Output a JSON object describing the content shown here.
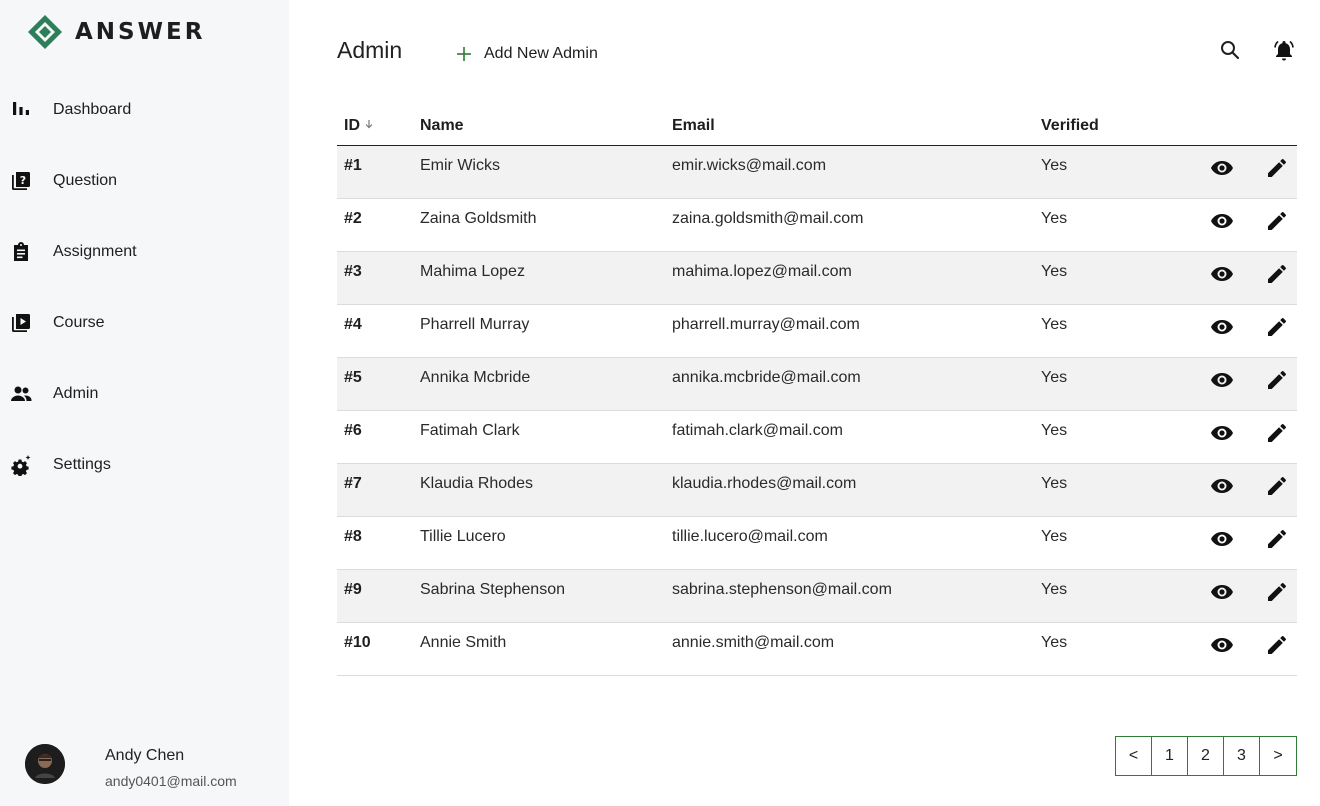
{
  "app": {
    "name": "ANSWER"
  },
  "sidebar": {
    "items": [
      {
        "label": "Dashboard",
        "icon": "bar-chart-icon"
      },
      {
        "label": "Question",
        "icon": "question-book-icon"
      },
      {
        "label": "Assignment",
        "icon": "clipboard-icon"
      },
      {
        "label": "Course",
        "icon": "video-library-icon"
      },
      {
        "label": "Admin",
        "icon": "people-icon"
      },
      {
        "label": "Settings",
        "icon": "gear-sparkle-icon"
      }
    ],
    "user": {
      "name": "Andy Chen",
      "email": "andy0401@mail.com"
    }
  },
  "header": {
    "title": "Admin",
    "add_label": "Add New Admin",
    "icons": [
      "search-icon",
      "bell-icon"
    ]
  },
  "table": {
    "columns": {
      "id": "ID",
      "name": "Name",
      "email": "Email",
      "verified": "Verified"
    },
    "rows": [
      {
        "id": "#1",
        "name": "Emir Wicks",
        "email": "emir.wicks@mail.com",
        "verified": "Yes"
      },
      {
        "id": "#2",
        "name": "Zaina Goldsmith",
        "email": "zaina.goldsmith@mail.com",
        "verified": "Yes"
      },
      {
        "id": "#3",
        "name": "Mahima Lopez",
        "email": "mahima.lopez@mail.com",
        "verified": "Yes"
      },
      {
        "id": "#4",
        "name": "Pharrell Murray",
        "email": "pharrell.murray@mail.com",
        "verified": "Yes"
      },
      {
        "id": "#5",
        "name": "Annika Mcbride",
        "email": "annika.mcbride@mail.com",
        "verified": "Yes"
      },
      {
        "id": "#6",
        "name": "Fatimah Clark",
        "email": "fatimah.clark@mail.com",
        "verified": "Yes"
      },
      {
        "id": "#7",
        "name": "Klaudia Rhodes",
        "email": "klaudia.rhodes@mail.com",
        "verified": "Yes"
      },
      {
        "id": "#8",
        "name": "Tillie Lucero",
        "email": "tillie.lucero@mail.com",
        "verified": "Yes"
      },
      {
        "id": "#9",
        "name": "Sabrina Stephenson",
        "email": "sabrina.stephenson@mail.com",
        "verified": "Yes"
      },
      {
        "id": "#10",
        "name": "Annie Smith",
        "email": "annie.smith@mail.com",
        "verified": "Yes"
      }
    ]
  },
  "pagination": {
    "prev": "<",
    "pages": [
      "1",
      "2",
      "3"
    ],
    "next": ">"
  },
  "colors": {
    "brand": "#2e7d5b",
    "pager_border": "#2e7d32",
    "row_alt": "#f2f2f2",
    "sidebar_bg": "#f5f7f8"
  }
}
